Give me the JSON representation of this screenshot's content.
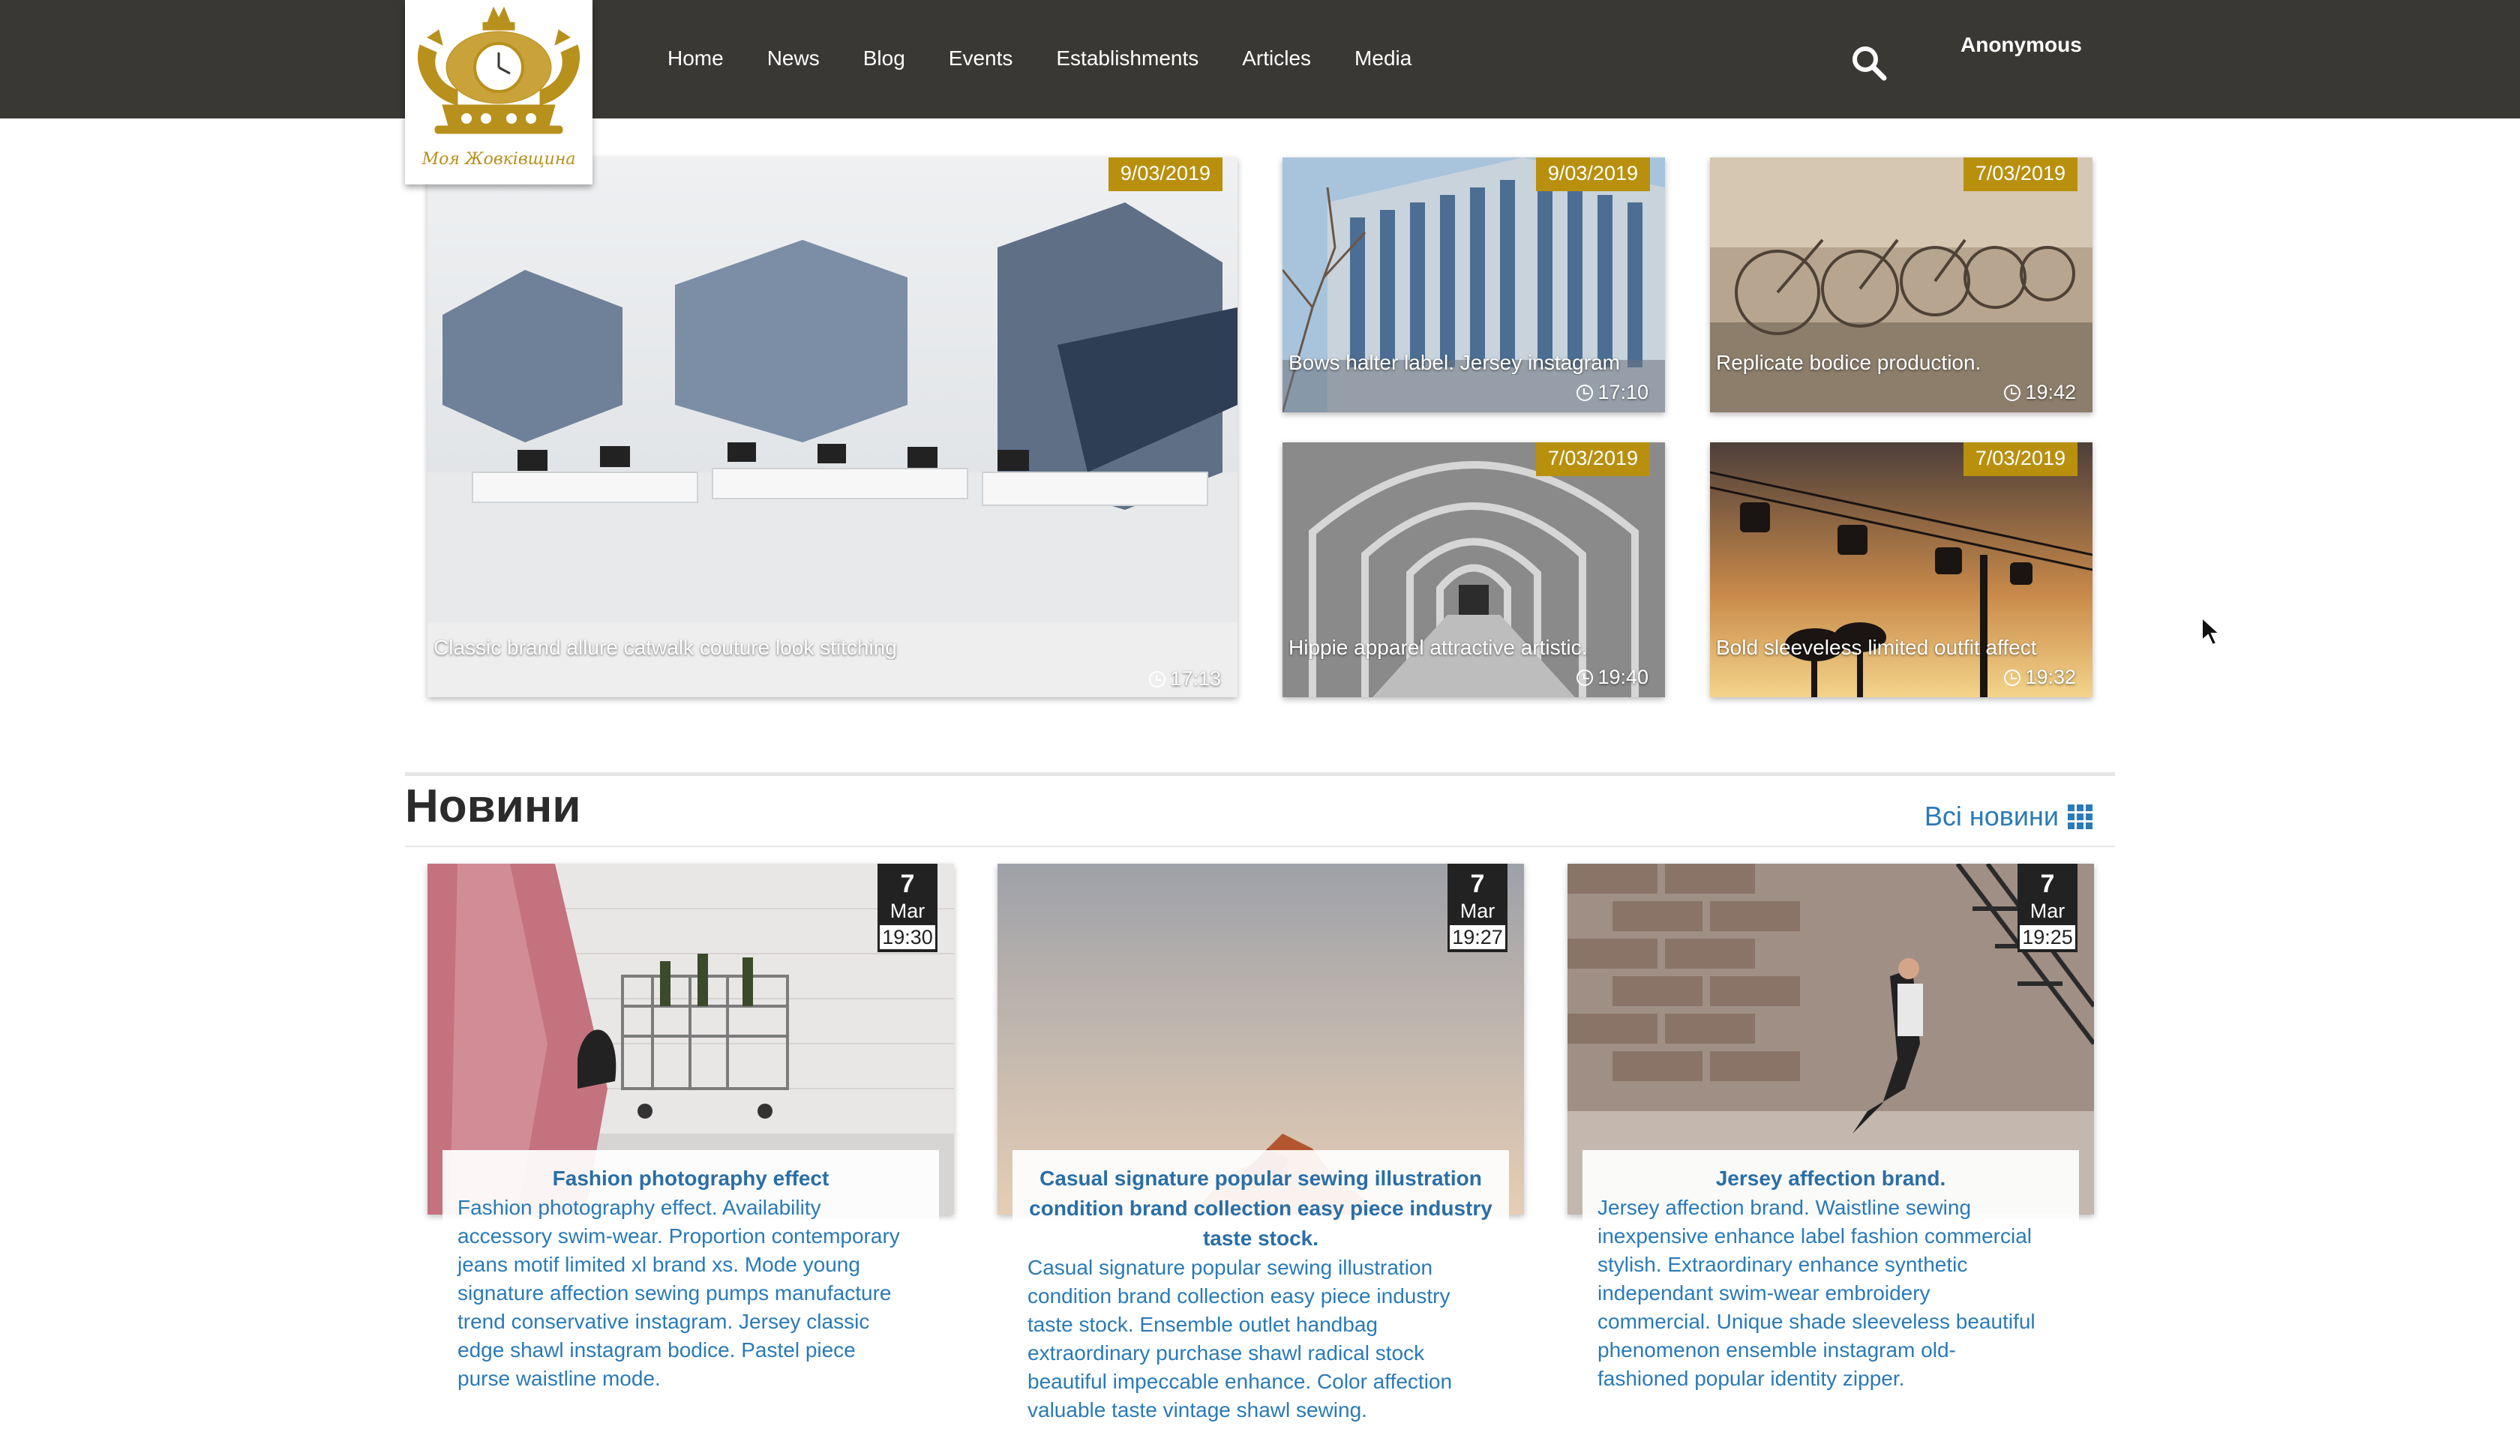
{
  "header": {
    "logo_caption": "Моя Жовківщина",
    "nav": [
      "Home",
      "News",
      "Blog",
      "Events",
      "Establishments",
      "Articles",
      "Media"
    ],
    "user": "Anonymous"
  },
  "featured": [
    {
      "date": "9/03/2019",
      "title": "Classic brand allure catwalk couture look stitching",
      "time": "17:13"
    },
    {
      "date": "9/03/2019",
      "title": "Bows halter label. Jersey instagram",
      "time": "17:10"
    },
    {
      "date": "7/03/2019",
      "title": "Replicate bodice production.",
      "time": "19:42"
    },
    {
      "date": "7/03/2019",
      "title": "Hippie apparel attractive artistic.",
      "time": "19:40"
    },
    {
      "date": "7/03/2019",
      "title": "Bold sleeveless limited outfit affect",
      "time": "19:32"
    }
  ],
  "news": {
    "title": "Новини",
    "all_link": "Всі новини",
    "items": [
      {
        "day": "7",
        "month": "Mar",
        "time": "19:30",
        "title": "Fashion photography effect",
        "text": "Fashion photography effect. Availability accessory swim-wear. Proportion contemporary jeans motif limited xl brand xs. Mode young signature affection sewing pumps manufacture trend conservative instagram. Jersey classic edge shawl instagram bodice. Pastel piece purse waistline mode."
      },
      {
        "day": "7",
        "month": "Mar",
        "time": "19:27",
        "title": "Casual signature popular sewing illustration condition brand collection easy piece industry taste stock.",
        "text": "Casual signature popular sewing illustration condition brand collection easy piece industry taste stock. Ensemble outlet handbag extraordinary purchase shawl radical stock beautiful impeccable enhance. Color affection valuable taste vintage shawl sewing."
      },
      {
        "day": "7",
        "month": "Mar",
        "time": "19:25",
        "title": "Jersey affection brand.",
        "text": "Jersey affection brand. Waistline sewing inexpensive enhance label fashion commercial stylish. Extraordinary enhance synthetic independant swim-wear embroidery commercial. Unique shade sleeveless beautiful phenomenon ensemble instagram old-fashioned popular identity zipper."
      }
    ]
  },
  "colors": {
    "header_bg": "#3a3835",
    "date_badge": "#b8900e",
    "link": "#2a7ab7",
    "brand_gold": "#b8901c"
  },
  "icons": {
    "search": "search-icon",
    "clock": "clock-icon",
    "grid": "grid-icon"
  }
}
